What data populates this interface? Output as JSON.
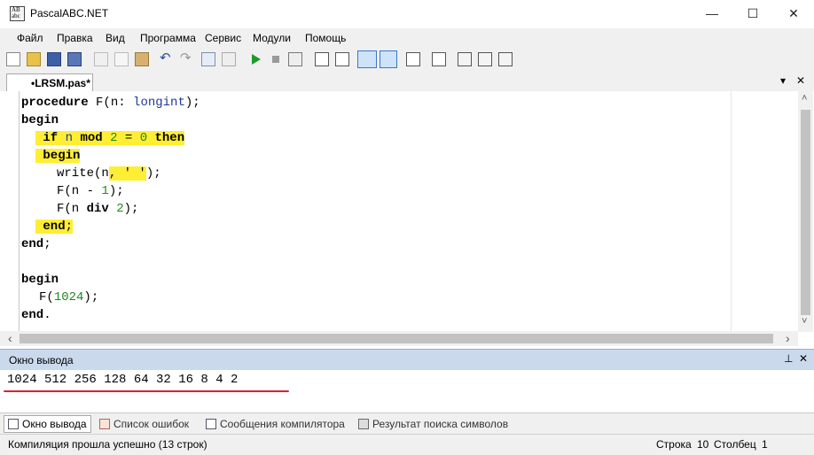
{
  "window": {
    "title": "PascalABC.NET",
    "icon_text": "AB",
    "icon_sub": "abc",
    "minimize": "—",
    "maximize": "☐",
    "close": "✕"
  },
  "menu": [
    "Файл",
    "Правка",
    "Вид",
    "Программа",
    "Сервис",
    "Модули",
    "Помощь"
  ],
  "toolbar_icons": [
    "new-file-icon",
    "open-file-icon",
    "save-icon",
    "save-all-icon",
    "cut-icon",
    "copy-icon",
    "paste-icon",
    "undo-icon",
    "redo-icon",
    "navigate-back-icon",
    "navigate-forward-icon",
    "run-icon",
    "stop-icon",
    "compile-icon",
    "step-over-icon",
    "step-into-icon",
    "console-icon",
    "terminal-icon",
    "page-icon",
    "form-icon",
    "debug-icon",
    "watch-icon",
    "locals-icon"
  ],
  "tab": {
    "label": "•LRSM.pas*",
    "dropdown": "▾",
    "close": "✕"
  },
  "code": {
    "l1": {
      "kw": "procedure",
      "a": " F(n: ",
      "ty": "longint",
      "b": ");"
    },
    "l2": {
      "kw": "begin"
    },
    "l3": {
      "kw1": "if",
      "a": " n ",
      "kw2": "mod",
      "b": " ",
      "n1": "2",
      "c": " = ",
      "n2": "0",
      "d": " ",
      "kw3": "then"
    },
    "l4": {
      "kw": "begin"
    },
    "l5": {
      "a": "write(n",
      "b": ", ' '",
      "c": ");"
    },
    "l6": {
      "a": "F(n - ",
      "n": "1",
      "b": ");"
    },
    "l7": {
      "a": "F(n ",
      "kw": "div",
      "b": " ",
      "n": "2",
      "c": ");"
    },
    "l8": {
      "kw": "end",
      "a": ";"
    },
    "l9": {
      "kw": "end",
      "a": ";"
    },
    "l11": {
      "kw": "begin"
    },
    "l12": {
      "a": "F(",
      "n": "1024",
      "b": ");"
    },
    "l13": {
      "kw": "end",
      "a": "."
    }
  },
  "output": {
    "header": "Окно вывода",
    "pin": "⊥",
    "close": "✕",
    "text": "1024 512 256 128 64 32 16 8 4 2"
  },
  "bottom_tabs": [
    "Окно вывода",
    "Список ошибок",
    "Сообщения компилятора",
    "Результат поиска символов"
  ],
  "status": {
    "message": "Компиляция прошла успешно (13 строк)",
    "row_label": "Строка",
    "row": "10",
    "col_label": "Столбец",
    "col": "1"
  },
  "scroll": {
    "up": "˄",
    "down": "˅",
    "left": "‹",
    "right": "›"
  }
}
